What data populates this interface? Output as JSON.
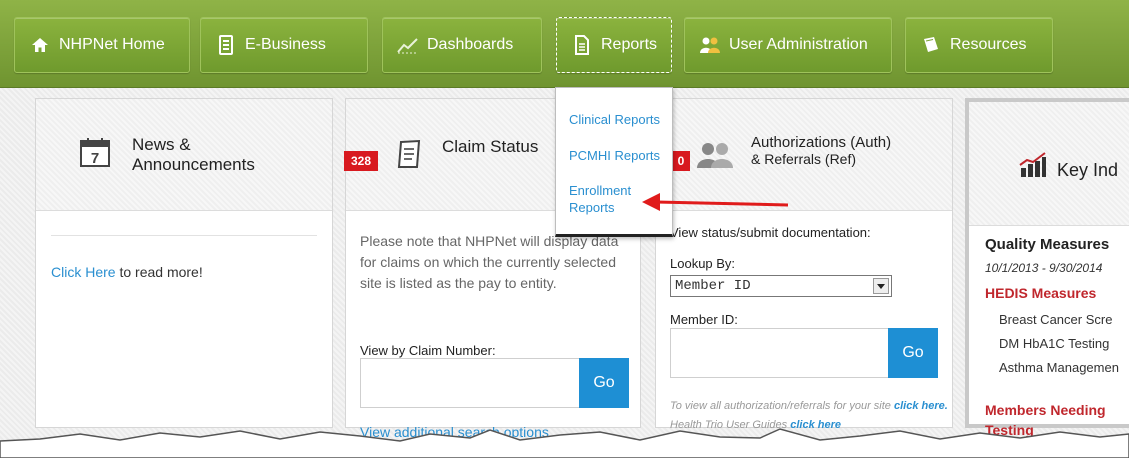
{
  "nav": {
    "items": [
      {
        "label": "NHPNet Home",
        "icon": "home-icon"
      },
      {
        "label": "E-Business",
        "icon": "server-icon"
      },
      {
        "label": "Dashboards",
        "icon": "chart-line-icon"
      },
      {
        "label": "Reports",
        "icon": "document-icon"
      },
      {
        "label": "User Administration",
        "icon": "users-icon"
      },
      {
        "label": "Resources",
        "icon": "book-icon"
      }
    ]
  },
  "reports_menu": {
    "items": [
      "Clinical Reports",
      "PCMHI Reports",
      "Enrollment",
      "Reports"
    ]
  },
  "news": {
    "title_line1": "News &",
    "title_line2": "Announcements",
    "calendar_day": "7",
    "link": "Click Here",
    "link_suffix": " to read more!"
  },
  "claims": {
    "badge": "328",
    "title": "Claim Status",
    "note": "Please note that NHPNet will display data for claims on which the currently selected site is listed as the pay to entity.",
    "claim_number_label": "View by Claim Number:",
    "go_label": "Go",
    "more_link": "View additional search options."
  },
  "auth": {
    "badge": "0",
    "title_line1": "Authorizations (Auth)",
    "title_line2": "& Referrals (Ref)",
    "instructions": "View status/submit documentation:",
    "lookup_label": "Lookup By:",
    "lookup_value": "Member ID",
    "member_id_label": "Member ID:",
    "go_label": "Go",
    "footer_text": "To view all authorization/referrals for your site ",
    "footer_link": "click here.",
    "guide_text": "Health Trio User Guides ",
    "guide_link": "click here"
  },
  "kpi": {
    "title": "Key Ind",
    "quality_heading": "Quality Measures",
    "date_range": "10/1/2013 - 9/30/2014",
    "hedis_heading": "HEDIS Measures",
    "measures": [
      "Breast Cancer Scre",
      "DM HbA1C Testing",
      "Asthma Managemen"
    ],
    "members_heading_line1": "Members Needing",
    "members_heading_line2": "Testing"
  },
  "colors": {
    "nav_green": "#7aa136",
    "link_blue": "#2a8fd0",
    "go_blue": "#1e8fd4",
    "badge_red": "#d8191f",
    "heading_red": "#c0272d"
  }
}
